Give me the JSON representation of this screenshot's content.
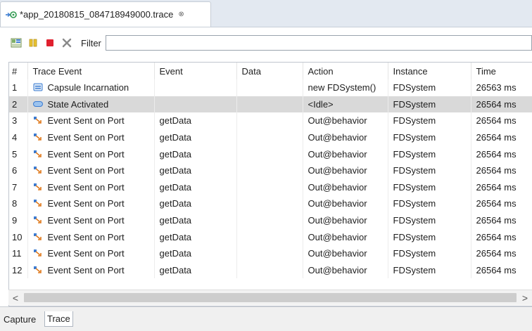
{
  "editor_tab": {
    "title": "*app_20180815_084718949000.trace",
    "close_glyph": "⊗",
    "icon": "trace-file-icon"
  },
  "toolbar": {
    "buttons": [
      {
        "name": "layout-icon"
      },
      {
        "name": "pause-icon"
      },
      {
        "name": "stop-icon"
      },
      {
        "name": "clear-icon"
      }
    ],
    "filter_label": "Filter",
    "filter_value": ""
  },
  "table": {
    "columns": [
      "#",
      "Trace Event",
      "Event",
      "Data",
      "Action",
      "Instance",
      "Time"
    ],
    "rows": [
      {
        "num": "1",
        "icon": "capsule-icon",
        "trace_event": "Capsule Incarnation",
        "event": "",
        "data": "",
        "action": "new FDSystem()",
        "instance": "FDSystem",
        "time": "26563 ms"
      },
      {
        "num": "2",
        "icon": "state-icon",
        "trace_event": "State Activated",
        "event": "",
        "data": "",
        "action": "<Idle>",
        "instance": "FDSystem",
        "time": "26564 ms"
      },
      {
        "num": "3",
        "icon": "port-event-icon",
        "trace_event": "Event Sent on Port",
        "event": "getData",
        "data": "",
        "action": "Out@behavior",
        "instance": "FDSystem",
        "time": "26564 ms"
      },
      {
        "num": "4",
        "icon": "port-event-icon",
        "trace_event": "Event Sent on Port",
        "event": "getData",
        "data": "",
        "action": "Out@behavior",
        "instance": "FDSystem",
        "time": "26564 ms"
      },
      {
        "num": "5",
        "icon": "port-event-icon",
        "trace_event": "Event Sent on Port",
        "event": "getData",
        "data": "",
        "action": "Out@behavior",
        "instance": "FDSystem",
        "time": "26564 ms"
      },
      {
        "num": "6",
        "icon": "port-event-icon",
        "trace_event": "Event Sent on Port",
        "event": "getData",
        "data": "",
        "action": "Out@behavior",
        "instance": "FDSystem",
        "time": "26564 ms"
      },
      {
        "num": "7",
        "icon": "port-event-icon",
        "trace_event": "Event Sent on Port",
        "event": "getData",
        "data": "",
        "action": "Out@behavior",
        "instance": "FDSystem",
        "time": "26564 ms"
      },
      {
        "num": "8",
        "icon": "port-event-icon",
        "trace_event": "Event Sent on Port",
        "event": "getData",
        "data": "",
        "action": "Out@behavior",
        "instance": "FDSystem",
        "time": "26564 ms"
      },
      {
        "num": "9",
        "icon": "port-event-icon",
        "trace_event": "Event Sent on Port",
        "event": "getData",
        "data": "",
        "action": "Out@behavior",
        "instance": "FDSystem",
        "time": "26564 ms"
      },
      {
        "num": "10",
        "icon": "port-event-icon",
        "trace_event": "Event Sent on Port",
        "event": "getData",
        "data": "",
        "action": "Out@behavior",
        "instance": "FDSystem",
        "time": "26564 ms"
      },
      {
        "num": "11",
        "icon": "port-event-icon",
        "trace_event": "Event Sent on Port",
        "event": "getData",
        "data": "",
        "action": "Out@behavior",
        "instance": "FDSystem",
        "time": "26564 ms"
      },
      {
        "num": "12",
        "icon": "port-event-icon",
        "trace_event": "Event Sent on Port",
        "event": "getData",
        "data": "",
        "action": "Out@behavior",
        "instance": "FDSystem",
        "time": "26564 ms"
      }
    ],
    "selected_row": 1
  },
  "scrollbar": {
    "left_arrow": "<",
    "right_arrow": ">"
  },
  "bottom_tabs": [
    {
      "label": "Capture",
      "active": false
    },
    {
      "label": "Trace",
      "active": true
    }
  ],
  "colors": {
    "tabstrip_bg": "#e3e9f1",
    "selected_row": "#d9d9d9",
    "stop_red": "#e0202e",
    "pause_yellow": "#e8c232",
    "icon_blue": "#3b7bd1",
    "icon_orange": "#e07b1f"
  }
}
